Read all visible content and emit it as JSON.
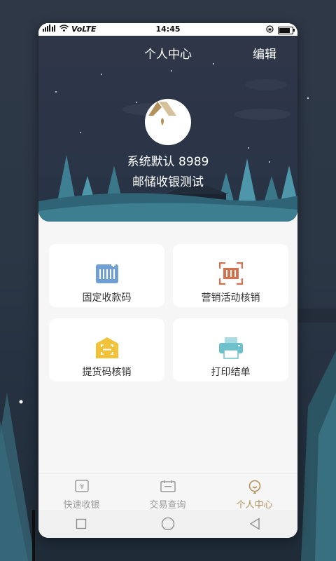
{
  "status_bar": {
    "network": "VoLTE",
    "time": "14:45"
  },
  "header": {
    "title": "个人中心",
    "edit_label": "编辑",
    "user_name_line": "系统默认 8989",
    "org_line": "邮储收银测试"
  },
  "cards": [
    {
      "label": "固定收款码",
      "icon": "fixed-qr-icon",
      "color": "#6f9fd3"
    },
    {
      "label": "营销活动核销",
      "icon": "marketing-verify-icon",
      "color": "#d4714f"
    },
    {
      "label": "提货码核销",
      "icon": "pickup-code-icon",
      "color": "#f1c23a"
    },
    {
      "label": "打印结单",
      "icon": "printer-icon",
      "color": "#6cc1cc"
    }
  ],
  "tabs": [
    {
      "label": "快速收银",
      "icon": "cashier-icon",
      "active": false
    },
    {
      "label": "交易查询",
      "icon": "calendar-icon",
      "active": false
    },
    {
      "label": "个人中心",
      "icon": "profile-icon",
      "active": true
    }
  ],
  "colors": {
    "accent": "#b3915a",
    "inactive": "#9a9a9a"
  }
}
